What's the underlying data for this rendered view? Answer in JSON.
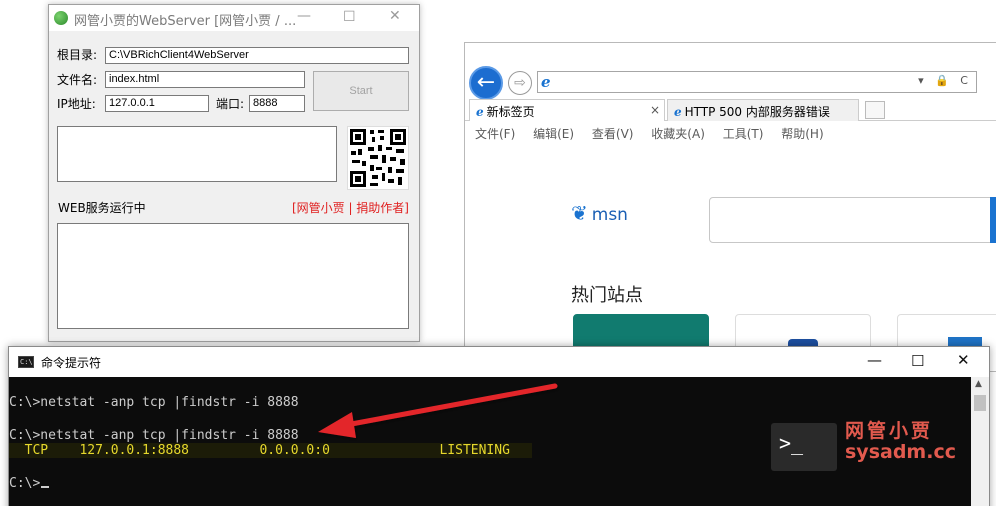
{
  "browser": {
    "tabs": [
      {
        "label": "新标签页",
        "close": "×"
      },
      {
        "label": "HTTP 500 内部服务器错误"
      }
    ],
    "menu": [
      "文件(F)",
      "编辑(E)",
      "查看(V)",
      "收藏夹(A)",
      "工具(T)",
      "帮助(H)"
    ],
    "msn_label": "msn",
    "hot_sites": "热门站点",
    "addr_tools": "▾ 🔒 C"
  },
  "webserver": {
    "title": "网管小贾的WebServer [网管小贾 / ...",
    "root_label": "根目录:",
    "root_value": "C:\\VBRichClient4WebServer",
    "file_label": "文件名:",
    "file_value": "index.html",
    "ip_label": "IP地址:",
    "ip_value": "127.0.0.1",
    "port_label": "端口:",
    "port_value": "8888",
    "start_label": "Start",
    "status": "WEB服务运行中",
    "donate": "[网管小贾 | 捐助作者]"
  },
  "cmd": {
    "title": "命令提示符",
    "lines": [
      "C:\\>netstat -anp tcp |findstr -i 8888",
      "C:\\>netstat -anp tcp |findstr -i 8888",
      "  TCP    127.0.0.1:8888         0.0.0.0:0              LISTENING",
      "C:\\>"
    ]
  },
  "watermark": {
    "line1": "网管小贾",
    "line2": "sysadm.cc"
  },
  "colors": {
    "accent_blue": "#1c6dd0",
    "listening_yellow": "#e6d82c",
    "donate_red": "#e02020",
    "arrow_red": "#e3262b"
  }
}
